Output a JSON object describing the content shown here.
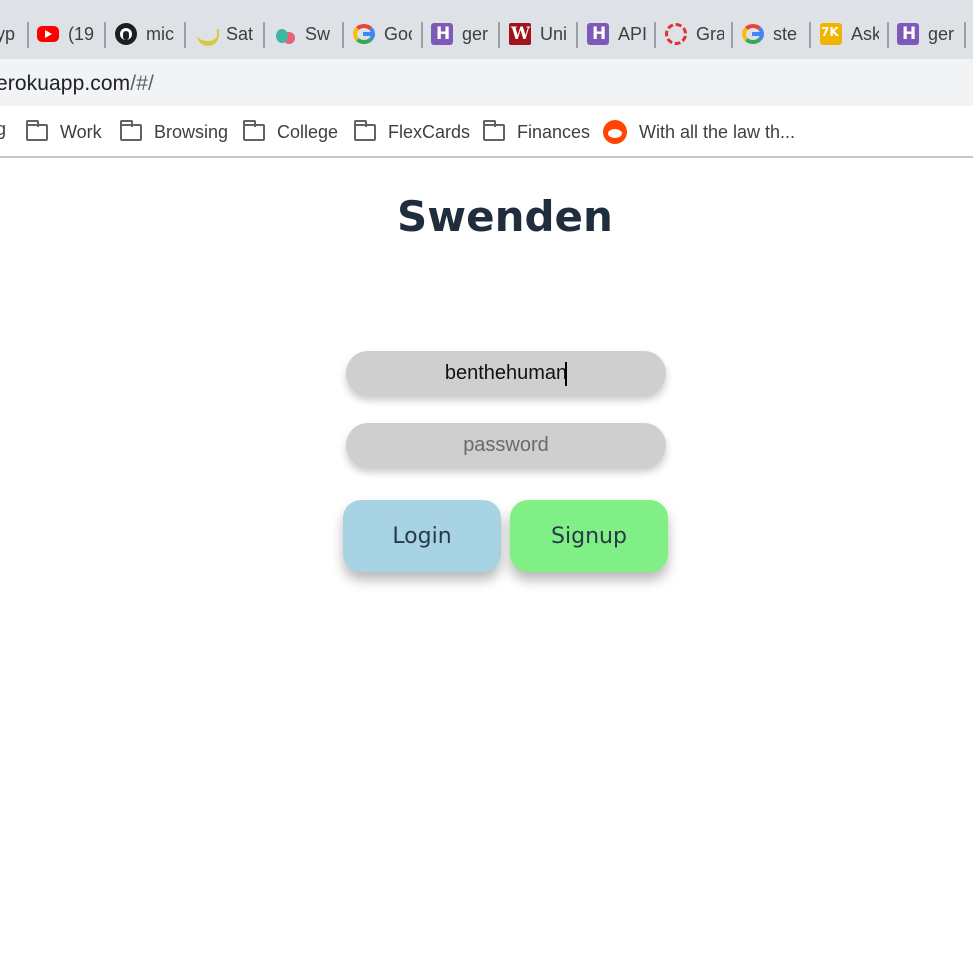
{
  "browser": {
    "tabs": [
      {
        "icon": "partial-tab",
        "title": "yp"
      },
      {
        "icon": "youtube-icon",
        "title": "(19"
      },
      {
        "icon": "github-icon",
        "title": "mic"
      },
      {
        "icon": "banana-icon",
        "title": "Sat"
      },
      {
        "icon": "swenden-icon",
        "title": "Sw"
      },
      {
        "icon": "google-icon",
        "title": "Goo"
      },
      {
        "icon": "heroku-icon",
        "title": "ger"
      },
      {
        "icon": "wikipedia-icon",
        "title": "Uni"
      },
      {
        "icon": "heroku-icon",
        "title": "API"
      },
      {
        "icon": "grafana-icon",
        "title": "Gra"
      },
      {
        "icon": "google-icon",
        "title": "ste"
      },
      {
        "icon": "ask-icon",
        "title": "Ask"
      },
      {
        "icon": "heroku-icon",
        "title": "ger"
      }
    ],
    "address_bar": {
      "host": "erokuapp.com",
      "path": "/#/"
    },
    "bookmarks": {
      "partial": "g",
      "items": [
        {
          "icon": "folder-icon",
          "label": "Work"
        },
        {
          "icon": "folder-icon",
          "label": "Browsing"
        },
        {
          "icon": "folder-icon",
          "label": "College"
        },
        {
          "icon": "folder-icon",
          "label": "FlexCards"
        },
        {
          "icon": "folder-icon",
          "label": "Finances"
        },
        {
          "icon": "reddit-icon",
          "label": "With all the law th..."
        }
      ]
    }
  },
  "app": {
    "title": "Swenden",
    "username_value": "benthehuman",
    "password_placeholder": "password",
    "login_label": "Login",
    "signup_label": "Signup"
  },
  "colors": {
    "title": "#1f2d3d",
    "field_bg": "#cfcfcf",
    "login_bg": "#a7d3e4",
    "signup_bg": "#7fef86"
  }
}
